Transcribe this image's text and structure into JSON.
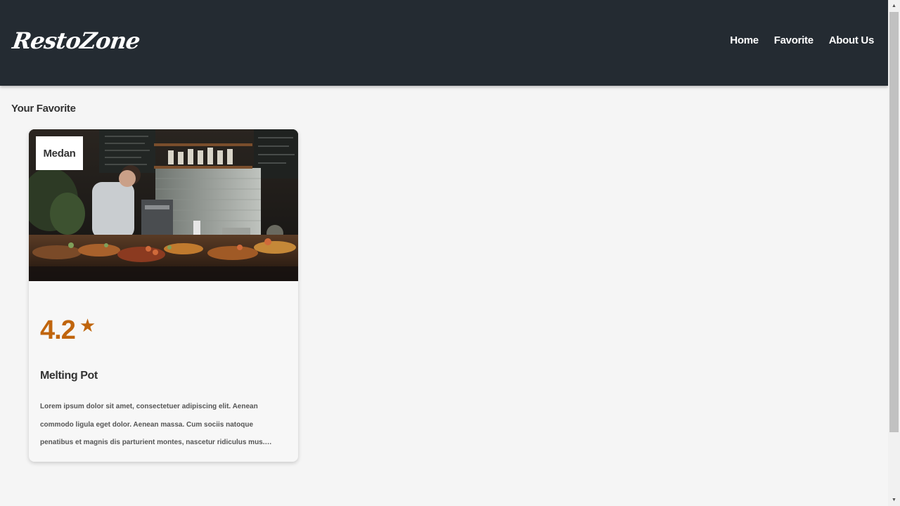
{
  "header": {
    "brand": "RestoZone",
    "nav": [
      {
        "label": "Home"
      },
      {
        "label": "Favorite"
      },
      {
        "label": "About Us"
      }
    ]
  },
  "main": {
    "section_title": "Your Favorite",
    "cards": [
      {
        "city": "Medan",
        "rating": "4.2",
        "star_icon": "star-icon",
        "name": "Melting Pot",
        "description": "Lorem ipsum dolor sit amet, consectetuer adipiscing elit. Aenean commodo ligula eget dolor. Aenean massa. Cum sociis natoque penatibus et magnis dis parturient montes, nascetur ridiculus mus. Donec quam felis, ultricies nec,..."
      }
    ]
  },
  "colors": {
    "header_bg": "#242b32",
    "accent_rating": "#c0650d",
    "page_bg": "#f5f5f5"
  }
}
